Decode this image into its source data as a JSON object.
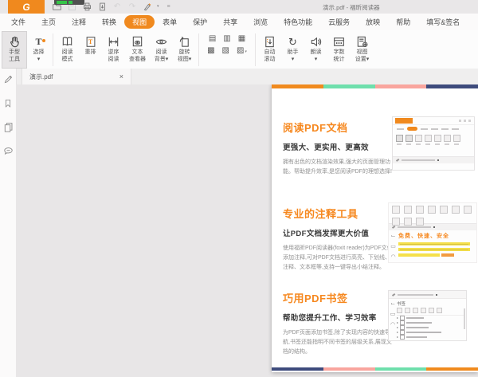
{
  "app": {
    "brand_color": "#f0891e",
    "window_title": "演示.pdf - 福昕阅读器"
  },
  "titlebar": {
    "logo_glyph": "G",
    "qat_icons": [
      "open-folder-icon",
      "save-icon",
      "print-icon",
      "export-doc-icon",
      "undo-icon",
      "redo-icon",
      "brush-icon",
      "customize-qat-icon"
    ],
    "undo_glyph": "↶",
    "redo_glyph": "↷",
    "more_glyph": "≡",
    "caret": "▾"
  },
  "menu_tabs": [
    {
      "label": "文件"
    },
    {
      "label": "主页"
    },
    {
      "label": "注释"
    },
    {
      "label": "转换"
    },
    {
      "label": "视图",
      "active": true
    },
    {
      "label": "表单"
    },
    {
      "label": "保护"
    },
    {
      "label": "共享"
    },
    {
      "label": "浏览"
    },
    {
      "label": "特色功能"
    },
    {
      "label": "云服务"
    },
    {
      "label": "放映"
    },
    {
      "label": "帮助"
    },
    {
      "label": "填写&签名"
    }
  ],
  "ribbon": {
    "hand": {
      "l1": "手型",
      "l2": "工具"
    },
    "select": {
      "glyph": "T",
      "l1": "选择",
      "l2": "▾"
    },
    "read_mode": {
      "l1": "阅读",
      "l2": "模式"
    },
    "reflow": {
      "glyph": "T",
      "l1": "重排",
      "l2": ""
    },
    "reverse": {
      "l1": "逆序",
      "l2": "阅读"
    },
    "text_viewer": {
      "l1": "文本",
      "l2": "查看器"
    },
    "read_bg": {
      "l1": "阅读",
      "l2": "背景▾"
    },
    "rotate": {
      "l1": "旋转",
      "l2": "视图▾"
    },
    "layout_icon_names": [
      "single-page-icon",
      "facing-pages-icon",
      "continuous-icon",
      "continuous-facing-icon",
      "book-mode-icon",
      "split-view-icon"
    ],
    "layout_glyphs": [
      "▤",
      "▥",
      "▦",
      "▩",
      "▧",
      "▨"
    ],
    "split_caret": "▾",
    "assistant_glyph": "↻",
    "auto_scroll": {
      "l1": "自动",
      "l2": "滚动"
    },
    "assistant": {
      "l1": "助手",
      "l2": "▾"
    },
    "read_aloud": {
      "l1": "朗读",
      "l2": "▾"
    },
    "word_count": {
      "l1": "字数",
      "l2": "统计"
    },
    "view_settings": {
      "l1": "视图",
      "l2": "设置▾"
    }
  },
  "doc_tab": {
    "label": "演示.pdf",
    "close_glyph": "×"
  },
  "sidebar_icon_names": [
    "edit-pencil-icon",
    "bookmark-icon",
    "pages-icon",
    "comment-icon"
  ],
  "document_page": {
    "accent": "#f6881f",
    "stripe_top": [
      "#f08a1e",
      "#6fdfac",
      "#f9a59e",
      "#3e4b7c"
    ],
    "stripe_bottom": [
      "#3e4b7c",
      "#f9a59e",
      "#6fdfac",
      "#f08a1e"
    ],
    "sections": [
      {
        "heading": "阅读PDF文档",
        "subheading": "更强大、更实用、更高效",
        "body": "拥有出色的文档渲染效果,强大的页面管理功能。帮助提升效率,是您阅读PDF的理想选择!"
      },
      {
        "heading": "专业的注释工具",
        "subheading": "让PDF文档发挥更大价值",
        "body": "使用福昕PDF阅读器(foxit reader)为PDF文件添加注释,可对PDF文档进行高亮、下划线、注释、文本框等,支持一键导出小结注释。"
      },
      {
        "heading": "巧用PDF书签",
        "subheading": "帮助您提升工作、学习效率",
        "body": "为PDF页面添加书签,除了实现内容的快速导航,书签还能指明不同书签的层级关系,展现文档的结构。"
      }
    ],
    "annotation_thumb_tagline": "免费、快速、安全",
    "bookmark_thumb_title": "书签"
  }
}
